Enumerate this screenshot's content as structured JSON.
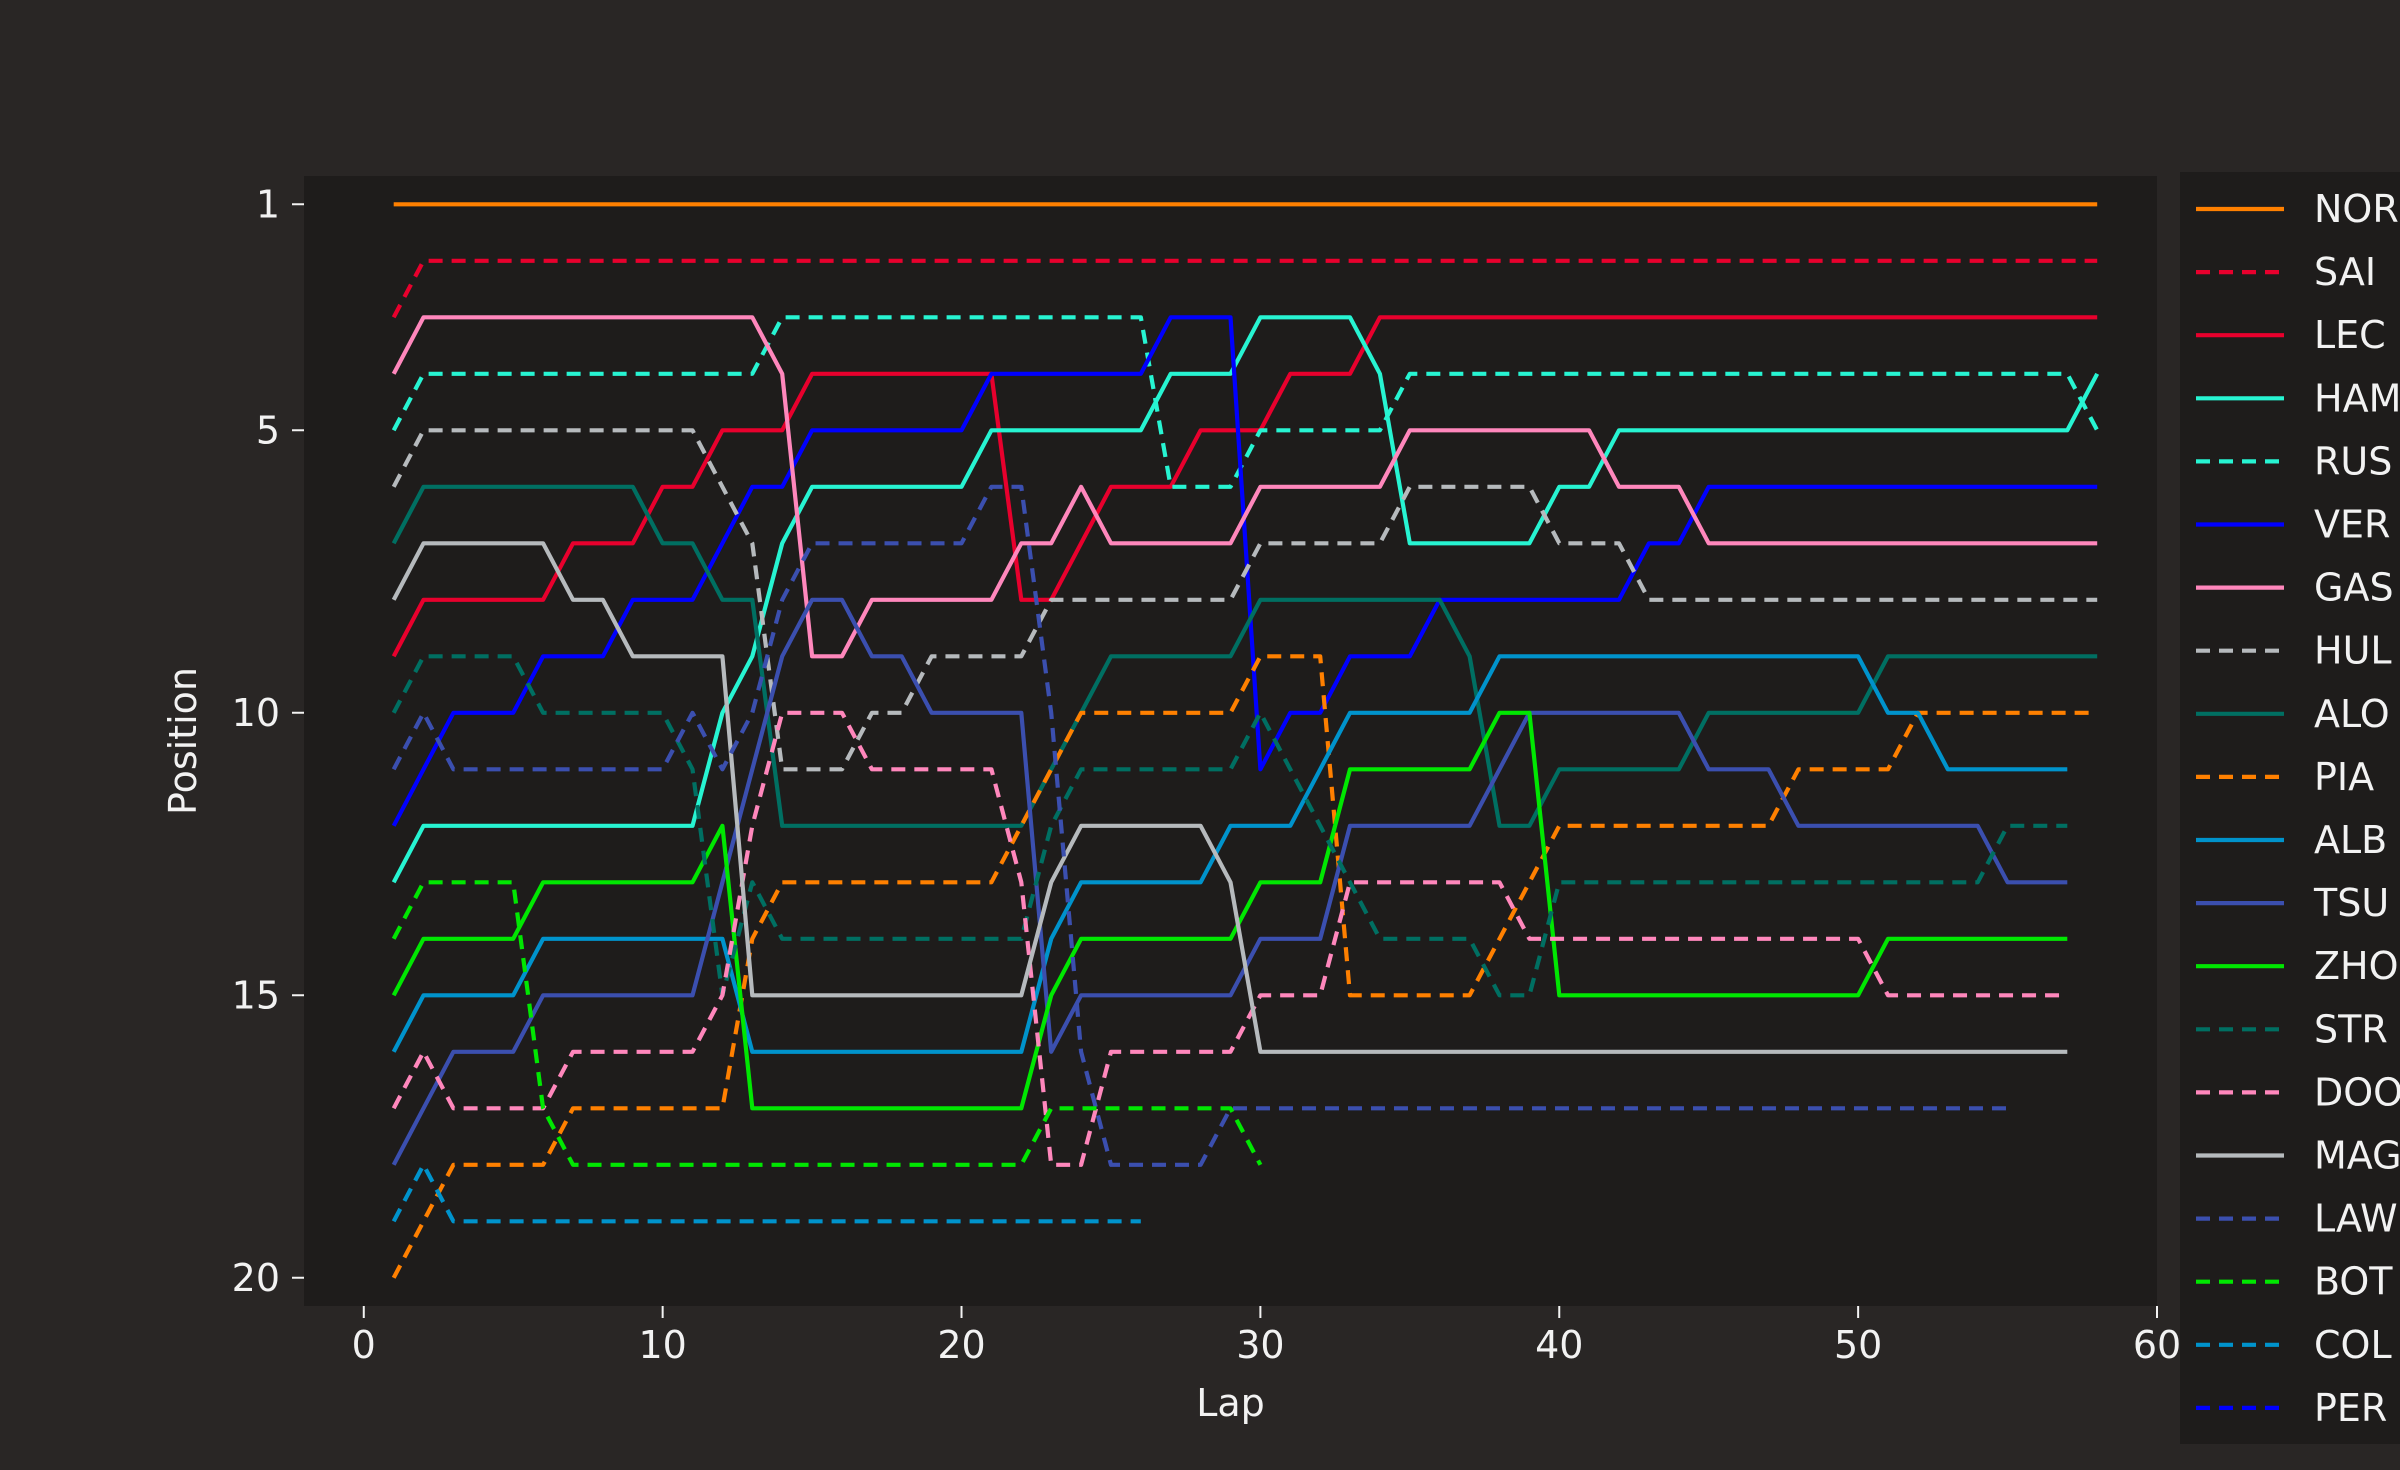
{
  "chart_data": {
    "type": "line",
    "title": "",
    "xlabel": "Lap",
    "ylabel": "Position",
    "xlim": [
      -2,
      60
    ],
    "ylim": [
      20.5,
      0.5
    ],
    "y_inverted": true,
    "xticks": [
      0,
      10,
      20,
      30,
      40,
      50,
      60
    ],
    "yticks": [
      1,
      5,
      10,
      15,
      20
    ],
    "grid": false,
    "legend_position": "right (outside plot, clipped)",
    "colors": {
      "figure_bg": "#292625",
      "axes_bg": "#1e1c1b",
      "text": "#f2f2f2"
    },
    "series": [
      {
        "name": "NOR",
        "color": "#ff8000",
        "dashed": false,
        "start": 1,
        "positions": [
          1,
          1,
          1,
          1,
          1,
          1,
          1,
          1,
          1,
          1,
          1,
          1,
          1,
          1,
          1,
          1,
          1,
          1,
          1,
          1,
          1,
          1,
          1,
          1,
          1,
          1,
          1,
          1,
          1,
          1,
          1,
          1,
          1,
          1,
          1,
          1,
          1,
          1,
          1,
          1,
          1,
          1,
          1,
          1,
          1,
          1,
          1,
          1,
          1,
          1,
          1,
          1,
          1,
          1,
          1,
          1,
          1,
          1
        ]
      },
      {
        "name": "SAI",
        "color": "#e8002d",
        "dashed": true,
        "start": 1,
        "positions": [
          3,
          2,
          2,
          2,
          2,
          2,
          2,
          2,
          2,
          2,
          2,
          2,
          2,
          2,
          2,
          2,
          2,
          2,
          2,
          2,
          2,
          2,
          2,
          2,
          2,
          2,
          2,
          2,
          2,
          2,
          2,
          2,
          2,
          2,
          2,
          2,
          2,
          2,
          2,
          2,
          2,
          2,
          2,
          2,
          2,
          2,
          2,
          2,
          2,
          2,
          2,
          2,
          2,
          2,
          2,
          2,
          2,
          2
        ]
      },
      {
        "name": "LEC",
        "color": "#e8002d",
        "dashed": false,
        "start": 1,
        "positions": [
          9,
          8,
          8,
          8,
          8,
          8,
          7,
          7,
          7,
          6,
          6,
          5,
          5,
          5,
          4,
          4,
          4,
          4,
          4,
          4,
          4,
          8,
          8,
          7,
          6,
          6,
          6,
          5,
          5,
          5,
          4,
          4,
          4,
          3,
          3,
          3,
          3,
          3,
          3,
          3,
          3,
          3,
          3,
          3,
          3,
          3,
          3,
          3,
          3,
          3,
          3,
          3,
          3,
          3,
          3,
          3,
          3,
          3
        ]
      },
      {
        "name": "HAM",
        "color": "#27f4d2",
        "dashed": false,
        "start": 1,
        "positions": [
          13,
          12,
          12,
          12,
          12,
          12,
          12,
          12,
          12,
          12,
          12,
          10,
          9,
          7,
          6,
          6,
          6,
          6,
          6,
          6,
          5,
          5,
          5,
          5,
          5,
          5,
          4,
          4,
          4,
          3,
          3,
          3,
          3,
          4,
          7,
          7,
          7,
          7,
          7,
          6,
          6,
          5,
          5,
          5,
          5,
          5,
          5,
          5,
          5,
          5,
          5,
          5,
          5,
          5,
          5,
          5,
          5,
          4
        ]
      },
      {
        "name": "RUS",
        "color": "#27f4d2",
        "dashed": true,
        "start": 1,
        "positions": [
          5,
          4,
          4,
          4,
          4,
          4,
          4,
          4,
          4,
          4,
          4,
          4,
          4,
          3,
          3,
          3,
          3,
          3,
          3,
          3,
          3,
          3,
          3,
          3,
          3,
          3,
          6,
          6,
          6,
          5,
          5,
          5,
          5,
          5,
          4,
          4,
          4,
          4,
          4,
          4,
          4,
          4,
          4,
          4,
          4,
          4,
          4,
          4,
          4,
          4,
          4,
          4,
          4,
          4,
          4,
          4,
          4,
          5
        ]
      },
      {
        "name": "VER",
        "color": "#0000ff",
        "dashed": false,
        "start": 1,
        "positions": [
          12,
          11,
          10,
          10,
          10,
          9,
          9,
          9,
          8,
          8,
          8,
          7,
          6,
          6,
          5,
          5,
          5,
          5,
          5,
          5,
          4,
          4,
          4,
          4,
          4,
          4,
          3,
          3,
          3,
          11,
          10,
          10,
          9,
          9,
          9,
          8,
          8,
          8,
          8,
          8,
          8,
          8,
          7,
          7,
          6,
          6,
          6,
          6,
          6,
          6,
          6,
          6,
          6,
          6,
          6,
          6,
          6,
          6
        ]
      },
      {
        "name": "GAS",
        "color": "#ff87bc",
        "dashed": false,
        "start": 1,
        "positions": [
          4,
          3,
          3,
          3,
          3,
          3,
          3,
          3,
          3,
          3,
          3,
          3,
          3,
          4,
          9,
          9,
          8,
          8,
          8,
          8,
          8,
          7,
          7,
          6,
          7,
          7,
          7,
          7,
          7,
          6,
          6,
          6,
          6,
          6,
          5,
          5,
          5,
          5,
          5,
          5,
          5,
          6,
          6,
          6,
          7,
          7,
          7,
          7,
          7,
          7,
          7,
          7,
          7,
          7,
          7,
          7,
          7,
          7
        ]
      },
      {
        "name": "HUL",
        "color": "#b6babd",
        "dashed": true,
        "start": 1,
        "positions": [
          6,
          5,
          5,
          5,
          5,
          5,
          5,
          5,
          5,
          5,
          5,
          6,
          7,
          11,
          11,
          11,
          10,
          10,
          9,
          9,
          9,
          9,
          8,
          8,
          8,
          8,
          8,
          8,
          8,
          7,
          7,
          7,
          7,
          7,
          6,
          6,
          6,
          6,
          6,
          7,
          7,
          7,
          8,
          8,
          8,
          8,
          8,
          8,
          8,
          8,
          8,
          8,
          8,
          8,
          8,
          8,
          8,
          8
        ]
      },
      {
        "name": "ALO",
        "color": "#006f62",
        "dashed": false,
        "start": 1,
        "positions": [
          7,
          6,
          6,
          6,
          6,
          6,
          6,
          6,
          6,
          7,
          7,
          8,
          8,
          12,
          12,
          12,
          12,
          12,
          12,
          12,
          12,
          12,
          11,
          10,
          9,
          9,
          9,
          9,
          9,
          8,
          8,
          8,
          8,
          8,
          8,
          8,
          9,
          12,
          12,
          11,
          11,
          11,
          11,
          11,
          10,
          10,
          10,
          10,
          10,
          10,
          9,
          9,
          9,
          9,
          9,
          9,
          9,
          9
        ]
      },
      {
        "name": "PIA",
        "color": "#ff8000",
        "dashed": true,
        "start": 1,
        "positions": [
          20,
          19,
          18,
          18,
          18,
          18,
          17,
          17,
          17,
          17,
          17,
          17,
          14,
          13,
          13,
          13,
          13,
          13,
          13,
          13,
          13,
          12,
          11,
          10,
          10,
          10,
          10,
          10,
          10,
          9,
          9,
          9,
          15,
          15,
          15,
          15,
          15,
          14,
          13,
          12,
          12,
          12,
          12,
          12,
          12,
          12,
          12,
          11,
          11,
          11,
          11,
          10,
          10,
          10,
          10,
          10,
          10,
          10
        ]
      },
      {
        "name": "ALB",
        "color": "#0093cc",
        "dashed": false,
        "start": 1,
        "positions": [
          16,
          15,
          15,
          15,
          15,
          14,
          14,
          14,
          14,
          14,
          14,
          14,
          16,
          16,
          16,
          16,
          16,
          16,
          16,
          16,
          16,
          16,
          14,
          13,
          13,
          13,
          13,
          13,
          12,
          12,
          12,
          11,
          10,
          10,
          10,
          10,
          10,
          9,
          9,
          9,
          9,
          9,
          9,
          9,
          9,
          9,
          9,
          9,
          9,
          9,
          10,
          10,
          11,
          11,
          11,
          11,
          11
        ]
      },
      {
        "name": "TSU",
        "color": "#3b4faf",
        "dashed": false,
        "start": 1,
        "positions": [
          18,
          17,
          16,
          16,
          16,
          15,
          15,
          15,
          15,
          15,
          15,
          13,
          11,
          9,
          8,
          8,
          9,
          9,
          10,
          10,
          10,
          10,
          16,
          15,
          15,
          15,
          15,
          15,
          15,
          14,
          14,
          14,
          12,
          12,
          12,
          12,
          12,
          11,
          10,
          10,
          10,
          10,
          10,
          10,
          11,
          11,
          11,
          12,
          12,
          12,
          12,
          12,
          12,
          12,
          13,
          13,
          13
        ]
      },
      {
        "name": "ZHO",
        "color": "#00e701",
        "dashed": false,
        "start": 1,
        "positions": [
          15,
          14,
          14,
          14,
          14,
          13,
          13,
          13,
          13,
          13,
          13,
          12,
          17,
          17,
          17,
          17,
          17,
          17,
          17,
          17,
          17,
          17,
          15,
          14,
          14,
          14,
          14,
          14,
          14,
          13,
          13,
          13,
          11,
          11,
          11,
          11,
          11,
          10,
          10,
          15,
          15,
          15,
          15,
          15,
          15,
          15,
          15,
          15,
          15,
          15,
          14,
          14,
          14,
          14,
          14,
          14,
          14
        ]
      },
      {
        "name": "STR",
        "color": "#006f62",
        "dashed": true,
        "start": 1,
        "positions": [
          10,
          9,
          9,
          9,
          9,
          10,
          10,
          10,
          10,
          10,
          11,
          15,
          13,
          14,
          14,
          14,
          14,
          14,
          14,
          14,
          14,
          14,
          12,
          11,
          11,
          11,
          11,
          11,
          11,
          10,
          11,
          12,
          13,
          14,
          14,
          14,
          14,
          15,
          15,
          13,
          13,
          13,
          13,
          13,
          13,
          13,
          13,
          13,
          13,
          13,
          13,
          13,
          13,
          13,
          12,
          12,
          12
        ]
      },
      {
        "name": "DOO",
        "color": "#ff87bc",
        "dashed": true,
        "start": 1,
        "positions": [
          17,
          16,
          17,
          17,
          17,
          17,
          16,
          16,
          16,
          16,
          16,
          15,
          12,
          10,
          10,
          10,
          11,
          11,
          11,
          11,
          11,
          13,
          18,
          18,
          16,
          16,
          16,
          16,
          16,
          15,
          15,
          15,
          13,
          13,
          13,
          13,
          13,
          13,
          14,
          14,
          14,
          14,
          14,
          14,
          14,
          14,
          14,
          14,
          14,
          14,
          15,
          15,
          15,
          15,
          15,
          15,
          15
        ]
      },
      {
        "name": "MAG",
        "color": "#b6babd",
        "dashed": false,
        "start": 1,
        "positions": [
          8,
          7,
          7,
          7,
          7,
          7,
          8,
          8,
          9,
          9,
          9,
          9,
          15,
          15,
          15,
          15,
          15,
          15,
          15,
          15,
          15,
          15,
          13,
          12,
          12,
          12,
          12,
          12,
          13,
          16,
          16,
          16,
          16,
          16,
          16,
          16,
          16,
          16,
          16,
          16,
          16,
          16,
          16,
          16,
          16,
          16,
          16,
          16,
          16,
          16,
          16,
          16,
          16,
          16,
          16,
          16,
          16
        ]
      },
      {
        "name": "LAW",
        "color": "#3b4faf",
        "dashed": true,
        "start": 1,
        "positions": [
          11,
          10,
          11,
          11,
          11,
          11,
          11,
          11,
          11,
          11,
          10,
          11,
          10,
          8,
          7,
          7,
          7,
          7,
          7,
          7,
          6,
          6,
          10,
          16,
          18,
          18,
          18,
          18,
          17,
          17,
          17,
          17,
          17,
          17,
          17,
          17,
          17,
          17,
          17,
          17,
          17,
          17,
          17,
          17,
          17,
          17,
          17,
          17,
          17,
          17,
          17,
          17,
          17,
          17,
          17
        ]
      },
      {
        "name": "BOT",
        "color": "#00e701",
        "dashed": true,
        "start": 1,
        "positions": [
          14,
          13,
          13,
          13,
          13,
          17,
          18,
          18,
          18,
          18,
          18,
          18,
          18,
          18,
          18,
          18,
          18,
          18,
          18,
          18,
          18,
          18,
          17,
          17,
          17,
          17,
          17,
          17,
          17,
          18
        ]
      },
      {
        "name": "COL",
        "color": "#0093cc",
        "dashed": true,
        "start": 1,
        "positions": [
          19,
          18,
          19,
          19,
          19,
          19,
          19,
          19,
          19,
          19,
          19,
          19,
          19,
          19,
          19,
          19,
          19,
          19,
          19,
          19,
          19,
          19,
          19,
          19,
          19,
          19
        ]
      },
      {
        "name": "PER",
        "color": "#0000ff",
        "dashed": true,
        "start": 1,
        "positions": []
      }
    ]
  }
}
